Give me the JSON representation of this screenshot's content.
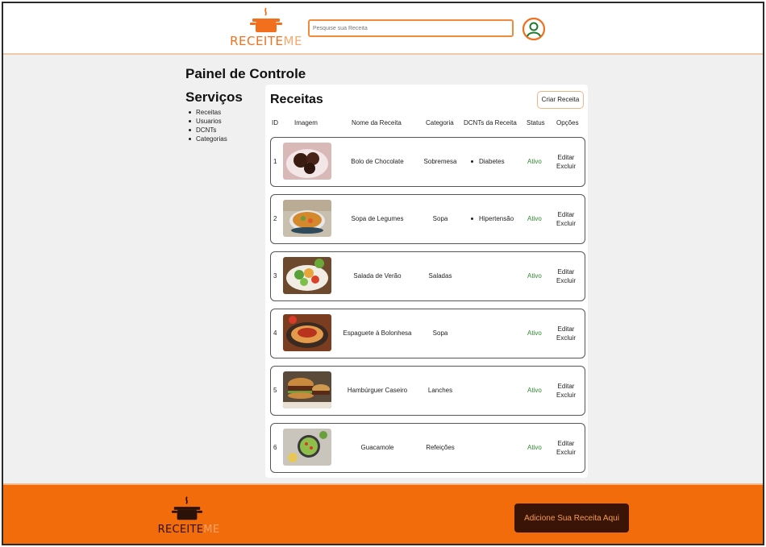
{
  "header": {
    "logo": {
      "text_a": "RECEITE",
      "text_b": "ME"
    },
    "search": {
      "placeholder": "Pesquise sua Receita"
    }
  },
  "main": {
    "panel_title": "Painel de Controle",
    "services": {
      "title": "Serviços",
      "items": [
        "Receitas",
        "Usuarios",
        "DCNTs",
        "Categorias"
      ]
    },
    "recipes": {
      "title": "Receitas",
      "create_label": "Criar Receita",
      "columns": [
        "ID",
        "Imagem",
        "Nome da Receita",
        "Categoria",
        "DCNTs da Receita",
        "Status",
        "Opções"
      ],
      "rows": [
        {
          "id": "1",
          "image": "chocolate-cake-photo",
          "name": "Bolo de Chocolate",
          "category": "Sobremesa",
          "dcnt": "Diabetes",
          "status": "Ativo",
          "edit": "Editar",
          "delete": "Excluir"
        },
        {
          "id": "2",
          "image": "vegetable-soup-photo",
          "name": "Sopa de Legumes",
          "category": "Sopa",
          "dcnt": "Hipertensão",
          "status": "Ativo",
          "edit": "Editar",
          "delete": "Excluir"
        },
        {
          "id": "3",
          "image": "summer-salad-photo",
          "name": "Salada de Verão",
          "category": "Saladas",
          "dcnt": "",
          "status": "Ativo",
          "edit": "Editar",
          "delete": "Excluir"
        },
        {
          "id": "4",
          "image": "spaghetti-bolognese-photo",
          "name": "Espaguete à Bolonhesa",
          "category": "Sopa",
          "dcnt": "",
          "status": "Ativo",
          "edit": "Editar",
          "delete": "Excluir"
        },
        {
          "id": "5",
          "image": "homemade-burger-photo",
          "name": "Hambúrguer Caseiro",
          "category": "Lanches",
          "dcnt": "",
          "status": "Ativo",
          "edit": "Editar",
          "delete": "Excluir"
        },
        {
          "id": "6",
          "image": "guacamole-photo",
          "name": "Guacamole",
          "category": "Refeições",
          "dcnt": "",
          "status": "Ativo",
          "edit": "Editar",
          "delete": "Excluir"
        }
      ]
    }
  },
  "footer": {
    "logo": {
      "text_a": "RECEITE",
      "text_b": "ME"
    },
    "cta_label": "Adicione Sua Receita Aqui"
  },
  "colors": {
    "brand_orange": "#f26c0c",
    "logo_orange": "#f26f1d",
    "logo_light": "#f7a96b",
    "status_green": "#2e8b2e",
    "cta_dark": "#3a1507"
  }
}
